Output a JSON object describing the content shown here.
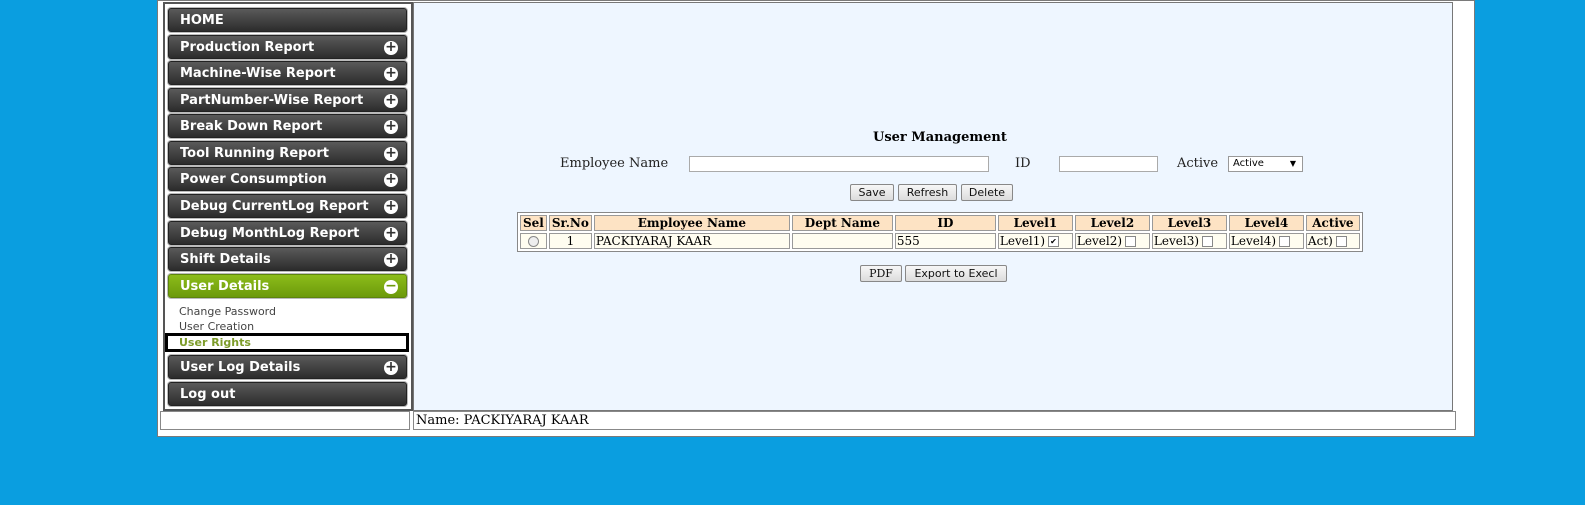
{
  "sidebar": {
    "items": [
      {
        "label": "HOME",
        "expand": false
      },
      {
        "label": "Production Report",
        "expand": true
      },
      {
        "label": "Machine-Wise Report",
        "expand": true
      },
      {
        "label": "PartNumber-Wise Report",
        "expand": true
      },
      {
        "label": "Break Down Report",
        "expand": true
      },
      {
        "label": "Tool Running Report",
        "expand": true
      },
      {
        "label": "Power Consumption",
        "expand": true
      },
      {
        "label": "Debug CurrentLog Report",
        "expand": true
      },
      {
        "label": "Debug MonthLog Report",
        "expand": true
      },
      {
        "label": "Shift Details",
        "expand": true
      },
      {
        "label": "User Details",
        "expand": true,
        "active": true
      },
      {
        "label": "User Log Details",
        "expand": true
      },
      {
        "label": "Log out",
        "expand": false
      }
    ],
    "sub_items": [
      "Change Password",
      "User Creation",
      "User Rights"
    ],
    "selected_sub": "User Rights"
  },
  "form": {
    "title": "User Management",
    "employee_label": "Employee Name",
    "employee_value": "",
    "id_label": "ID",
    "id_value": "",
    "active_label": "Active",
    "active_value": "Active",
    "save": "Save",
    "refresh": "Refresh",
    "delete": "Delete",
    "pdf": "PDF",
    "export": "Export to Execl"
  },
  "table": {
    "headers": [
      "Sel",
      "Sr.No",
      "Employee Name",
      "Dept Name",
      "ID",
      "Level1",
      "Level2",
      "Level3",
      "Level4",
      "Active"
    ],
    "rows": [
      {
        "srno": "1",
        "name": "PACKIYARAJ KAAR",
        "dept": "",
        "id": "555",
        "levels": [
          {
            "label": "Level1)",
            "checked": true
          },
          {
            "label": "Level2)",
            "checked": false
          },
          {
            "label": "Level3)",
            "checked": false
          },
          {
            "label": "Level4)",
            "checked": false
          },
          {
            "label": "Act)",
            "checked": false
          }
        ]
      }
    ]
  },
  "footer": {
    "name_line": "Name: PACKIYARAJ KAAR"
  },
  "colors": {
    "background": "#0a9ee0",
    "active_nav": "#7cac12",
    "header_cell": "#fde3c4"
  }
}
